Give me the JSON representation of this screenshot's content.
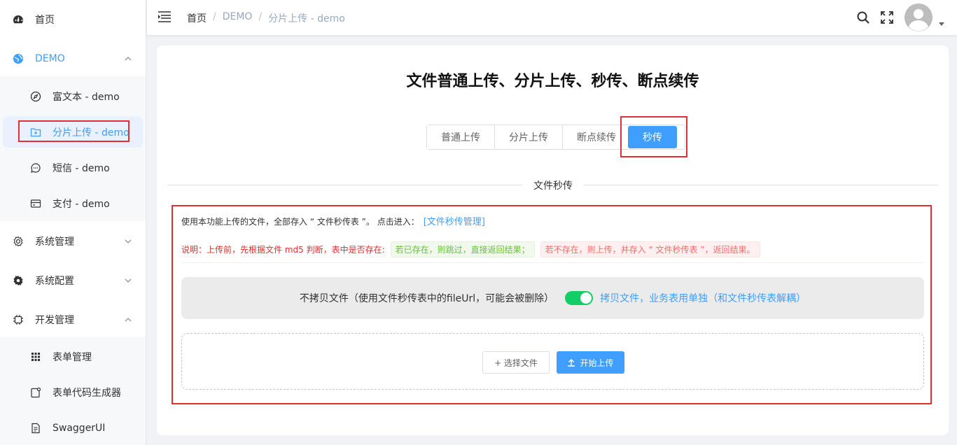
{
  "sidebar": {
    "items": [
      {
        "label": "首页",
        "icon": "dashboard-icon"
      },
      {
        "label": "DEMO",
        "icon": "globe-icon"
      },
      {
        "label": "富文本 - demo",
        "icon": "compass-icon"
      },
      {
        "label": "分片上传 - demo",
        "icon": "folder-upload-icon"
      },
      {
        "label": "短信 - demo",
        "icon": "chat-icon"
      },
      {
        "label": "支付 - demo",
        "icon": "credit-card-icon"
      },
      {
        "label": "系统管理",
        "icon": "gear-icon"
      },
      {
        "label": "系统配置",
        "icon": "cog-icon"
      },
      {
        "label": "开发管理",
        "icon": "chip-icon"
      },
      {
        "label": "表单管理",
        "icon": "grid-icon"
      },
      {
        "label": "表单代码生成器",
        "icon": "code-gen-icon"
      },
      {
        "label": "SwaggerUI",
        "icon": "document-icon"
      }
    ]
  },
  "header": {
    "breadcrumb": [
      "首页",
      "DEMO",
      "分片上传 - demo"
    ],
    "separator": "/"
  },
  "main": {
    "title": "文件普通上传、分片上传、秒传、断点续传",
    "tabs": [
      {
        "label": "普通上传"
      },
      {
        "label": "分片上传"
      },
      {
        "label": "断点续传"
      },
      {
        "label": "秒传"
      }
    ],
    "divider_text": "文件秒传",
    "info_text": "使用本功能上传的文件，全部存入 “ 文件秒传表 ”。 点击进入：",
    "info_link": "[文件秒传管理]",
    "note_text": "说明：上传前，先根据文件 md5 判断，表中是否存在:",
    "tag_exists": "若已存在，则跳过，直接返回结果；",
    "tag_not_exists": "若不存在，则上传，并存入 “ 文件秒传表 ”，返回结果。",
    "switch_off_label": "不拷贝文件（使用文件秒传表中的fileUrl，可能会被删除）",
    "switch_on_label": "拷贝文件，业务表用单独（和文件秒传表解耦）",
    "switch_value": true,
    "select_button": "+ 选择文件",
    "start_button": "开始上传"
  },
  "colors": {
    "primary": "#409eff",
    "success_toggle": "#13ce66",
    "highlight_box": "#e0302f"
  }
}
